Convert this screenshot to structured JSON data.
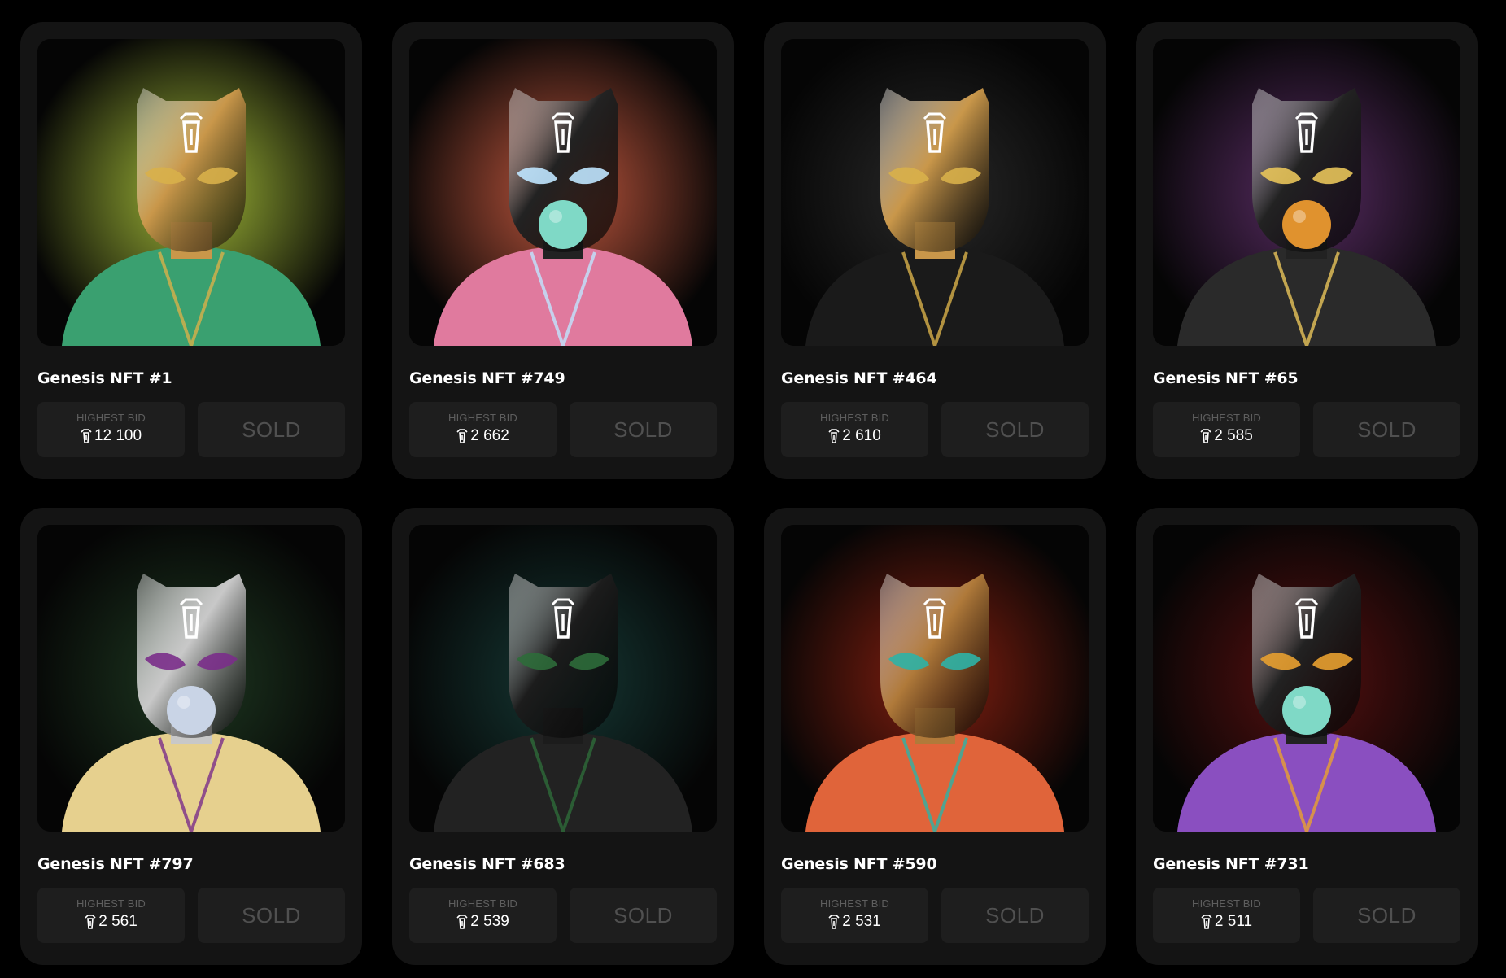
{
  "icons": {
    "token": "token-icon"
  },
  "labels": {
    "highest_bid": "HIGHEST BID",
    "sold": "SOLD"
  },
  "nfts": [
    {
      "title": "Genesis NFT #1",
      "bid": "12 100",
      "mask": "#c9974a",
      "glow": "#a9c23a",
      "outfit": "#3aa070",
      "accent": "#d8b04a",
      "bubble": ""
    },
    {
      "title": "Genesis NFT #749",
      "bid": "2 662",
      "mask": "#222222",
      "glow": "#c85a40",
      "outfit": "#e07a9e",
      "accent": "#bfe6ff",
      "bubble": "#7fd9c6"
    },
    {
      "title": "Genesis NFT #464",
      "bid": "2 610",
      "mask": "#c9974a",
      "glow": "#2a2a2a",
      "outfit": "#1a1a1a",
      "accent": "#d8b04a",
      "bubble": ""
    },
    {
      "title": "Genesis NFT #65",
      "bid": "2 585",
      "mask": "#222222",
      "glow": "#5b2d66",
      "outfit": "#2a2a2a",
      "accent": "#e8c45a",
      "bubble": "#e0922e"
    },
    {
      "title": "Genesis NFT #797",
      "bid": "2 561",
      "mask": "#c8c8c8",
      "glow": "#1f3a22",
      "outfit": "#e6d08e",
      "accent": "#7a2d8a",
      "bubble": "#c9d4e6"
    },
    {
      "title": "Genesis NFT #683",
      "bid": "2 539",
      "mask": "#1c1c1c",
      "glow": "#163a36",
      "outfit": "#222222",
      "accent": "#2e6b3a",
      "bubble": ""
    },
    {
      "title": "Genesis NFT #590",
      "bid": "2 531",
      "mask": "#b07a3a",
      "glow": "#8a2010",
      "outfit": "#e0643a",
      "accent": "#2db3a6",
      "bubble": ""
    },
    {
      "title": "Genesis NFT #731",
      "bid": "2 511",
      "mask": "#222222",
      "glow": "#5a1010",
      "outfit": "#8a4fc0",
      "accent": "#e8a030",
      "bubble": "#7fd9c6"
    }
  ]
}
